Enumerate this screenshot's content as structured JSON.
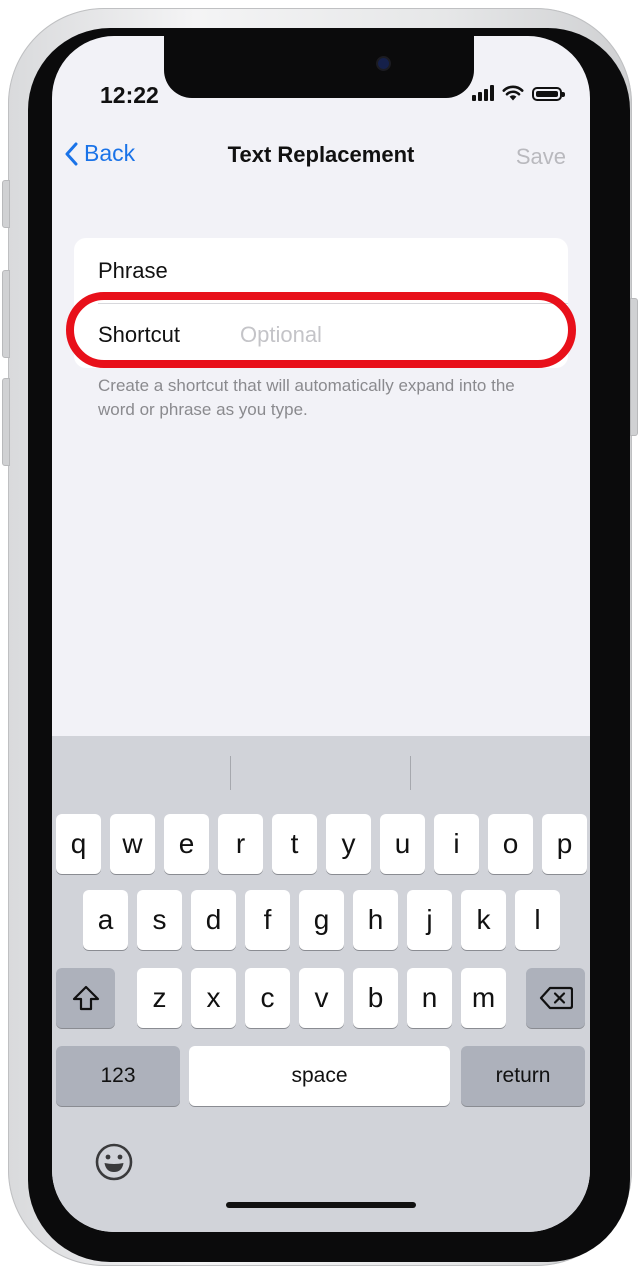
{
  "status_bar": {
    "time": "12:22"
  },
  "nav": {
    "back_label": "Back",
    "title": "Text Replacement",
    "save_label": "Save"
  },
  "form": {
    "phrase_label": "Phrase",
    "shortcut_label": "Shortcut",
    "shortcut_placeholder": "Optional",
    "footer_note": "Create a shortcut that will automatically expand into the word or phrase as you type."
  },
  "keyboard": {
    "row1": [
      "q",
      "w",
      "e",
      "r",
      "t",
      "y",
      "u",
      "i",
      "o",
      "p"
    ],
    "row2": [
      "a",
      "s",
      "d",
      "f",
      "g",
      "h",
      "j",
      "k",
      "l"
    ],
    "row3": [
      "z",
      "x",
      "c",
      "v",
      "b",
      "n",
      "m"
    ],
    "numbers_label": "123",
    "space_label": "space",
    "return_label": "return",
    "icons": {
      "shift": "shift-icon",
      "delete": "delete-icon",
      "emoji": "emoji-icon"
    }
  },
  "colors": {
    "accent": "#1a73e8",
    "highlight": "#e8101a",
    "save_disabled": "#b9b9be"
  }
}
